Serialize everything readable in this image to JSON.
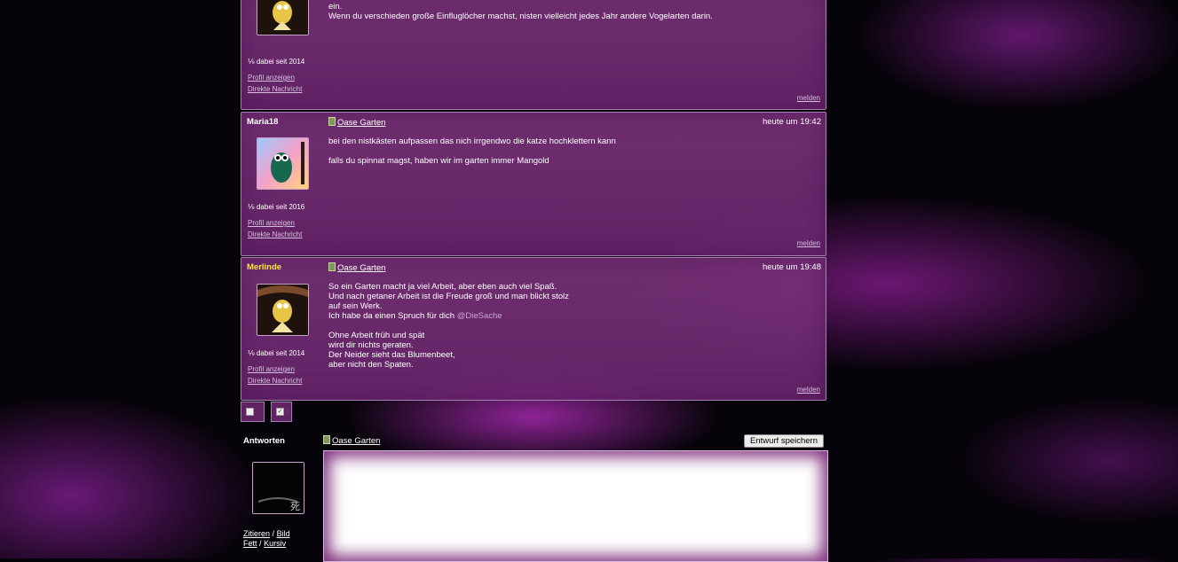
{
  "posts": [
    {
      "author": "",
      "since": "dabei seit 2014",
      "profile": "Profil anzeigen",
      "message": "Direkte Nachricht",
      "body": "ein.\nWenn du verschieden große Einfluglöcher machst, nisten vielleicht jedes Jahr andere Vogelarten darin.",
      "report": "melden"
    },
    {
      "author": "Maria18",
      "topic": "Oase Garten",
      "time": "heute um 19:42",
      "since": "dabei seit 2016",
      "profile": "Profil anzeigen",
      "message": "Direkte Nachricht",
      "body": "bei den nistkästen aufpassen das nich irrgendwo die katze hochklettern kann\n\nfalls du spinnat magst, haben wir im garten immer Mangold",
      "report": "melden"
    },
    {
      "author": "Merlinde",
      "topic": "Oase Garten",
      "time": "heute um 19:48",
      "since": "dabei seit 2014",
      "profile": "Profil anzeigen",
      "message": "Direkte Nachricht",
      "body_a": "So ein Garten macht ja viel Arbeit, aber eben auch viel Spaß.\nUnd nach getaner Arbeit ist die Freude groß und man blickt stolz\nauf sein Werk.\nIch habe da einen Spruch für dich ",
      "mention": "@DieSache",
      "body_b": "Ohne Arbeit früh und spät\nwird dir nichts geraten.\nDer Neider sieht das Blumenbeet,\naber nicht den Spaten.",
      "report": "melden"
    }
  ],
  "reply": {
    "heading": "Antworten",
    "topic": "Oase Garten",
    "save_draft": "Entwurf speichern",
    "quote": "Zitieren",
    "image": "Bild",
    "bold": "Fett",
    "italic": "Kursiv",
    "sep": "/"
  },
  "colors": {
    "accent": "#ffe14a",
    "panel": "#7a3478"
  }
}
